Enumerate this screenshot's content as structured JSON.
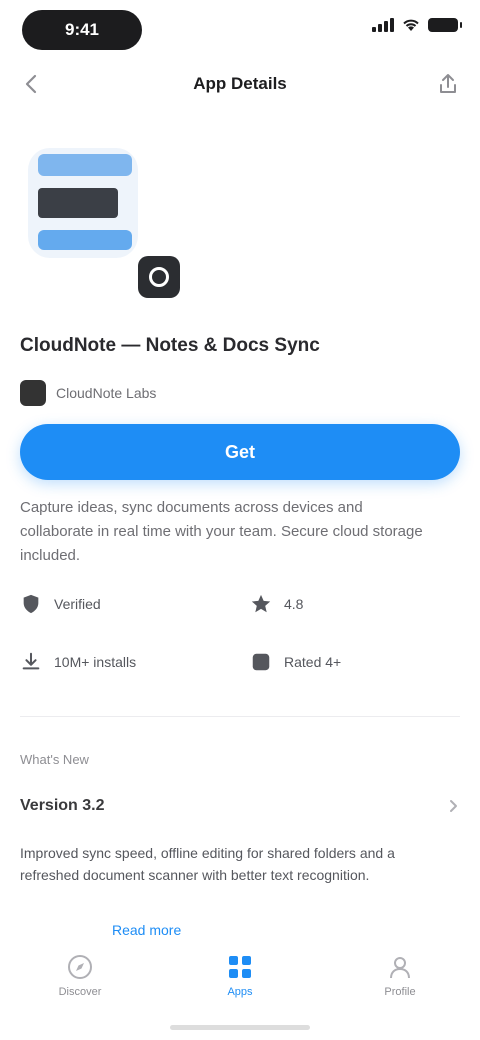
{
  "status_bar": {
    "time": "9:41"
  },
  "nav": {
    "title": "App Details"
  },
  "app": {
    "name": "CloudNote — Notes & Docs Sync",
    "developer": "CloudNote Labs",
    "get_label": "Get",
    "description": "Capture ideas, sync documents across devices and collaborate in real time with your team. Secure cloud storage included."
  },
  "info": [
    {
      "icon": "shield-icon",
      "text": "Verified"
    },
    {
      "icon": "star-icon",
      "text": "4.8"
    },
    {
      "icon": "download-icon",
      "text": "10M+ installs"
    },
    {
      "icon": "age-icon",
      "text": "Rated 4+"
    }
  ],
  "section": {
    "label": "What's New",
    "title": "Version 3.2",
    "body": "Improved sync speed, offline editing for shared folders and a refreshed document scanner with better text recognition.",
    "more_link": "Read more"
  },
  "tabs": [
    {
      "label": "Discover",
      "icon": "compass-icon"
    },
    {
      "label": "Apps",
      "icon": "apps-icon"
    },
    {
      "label": "Profile",
      "icon": "user-icon"
    }
  ],
  "colors": {
    "accent": "#1e8df5",
    "text_primary": "#1d1d1f",
    "text_secondary": "#6e6e73"
  }
}
